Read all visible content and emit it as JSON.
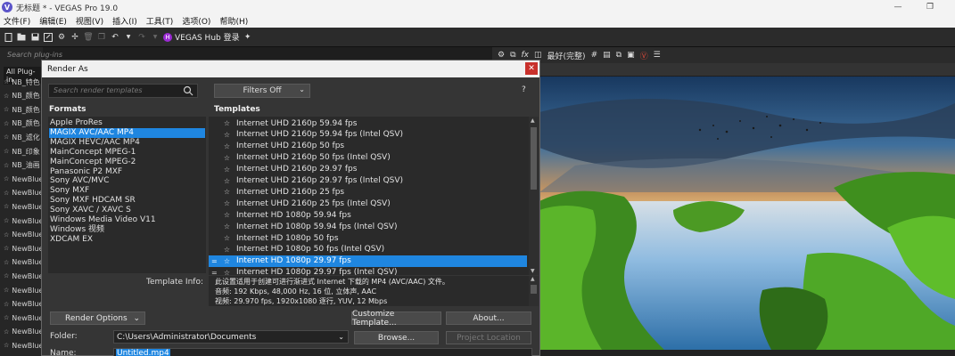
{
  "window": {
    "title": "无标题 * - VEGAS Pro 19.0",
    "app_icon": "V",
    "minimize": "—",
    "maximize": "❐"
  },
  "menu": [
    "文件(F)",
    "编辑(E)",
    "视图(V)",
    "插入(I)",
    "工具(T)",
    "选项(O)",
    "帮助(H)"
  ],
  "toolbar": {
    "hub_label": "VEGAS Hub 登录"
  },
  "plugins": {
    "search_placeholder": "Search plug-ins",
    "tab_label": "All Plug-in",
    "items": [
      "NB_特色",
      "NB_颜色",
      "NB_颜色",
      "NB_颜色",
      "NB_滤化",
      "NB_印象",
      "NB_油画",
      "NewBlue",
      "NewBlue",
      "NewBlue",
      "NewBlue",
      "NewBlue",
      "NewBlue",
      "NewBlue",
      "NewBlue",
      "NewBlue",
      "NewBlue",
      "NewBlue",
      "NewBlue",
      "NewBlue",
      "NewBlue"
    ]
  },
  "preview_toolbar": {
    "quality": "最好(完整)"
  },
  "dialog": {
    "title": "Render As",
    "close": "✕",
    "search_placeholder": "Search render templates",
    "filters_label": "Filters Off",
    "help": "?",
    "formats_header": "Formats",
    "templates_header": "Templates",
    "formats": [
      "Apple ProRes",
      "MAGIX AVC/AAC MP4",
      "MAGIX HEVC/AAC MP4",
      "MainConcept MPEG-1",
      "MainConcept MPEG-2",
      "Panasonic P2 MXF",
      "Sony AVC/MVC",
      "Sony MXF",
      "Sony MXF HDCAM SR",
      "Sony XAVC / XAVC S",
      "Windows Media Video V11",
      "Windows 视频",
      "XDCAM EX"
    ],
    "selected_format_index": 1,
    "templates": [
      "Internet UHD 2160p 59.94 fps",
      "Internet UHD 2160p 59.94 fps (Intel QSV)",
      "Internet UHD 2160p 50 fps",
      "Internet UHD 2160p 50 fps (Intel QSV)",
      "Internet UHD 2160p 29.97 fps",
      "Internet UHD 2160p 29.97 fps (Intel QSV)",
      "Internet UHD 2160p 25 fps",
      "Internet UHD 2160p 25 fps (Intel QSV)",
      "Internet HD 1080p 59.94 fps",
      "Internet HD 1080p 59.94 fps (Intel QSV)",
      "Internet HD 1080p 50 fps",
      "Internet HD 1080p 50 fps (Intel QSV)",
      "Internet HD 1080p 29.97 fps",
      "Internet HD 1080p 29.97 fps (Intel QSV)"
    ],
    "selected_template_index": 12,
    "template_info_label": "Template Info:",
    "template_info": [
      "此设置适用于创建可进行渐进式 Internet 下载的 MP4 (AVC/AAC) 文件。",
      "音频: 192 Kbps, 48,000 Hz, 16 位, 立体声, AAC",
      "视频: 29.970 fps, 1920x1080 逐行, YUV, 12 Mbps"
    ],
    "render_options": "Render Options",
    "customize_template": "Customize Template...",
    "about": "About...",
    "folder_label": "Folder:",
    "folder_value": "C:\\Users\\Administrator\\Documents",
    "browse": "Browse...",
    "project_location": "Project Location",
    "name_label": "Name:",
    "name_value": "Untitled.mp4"
  }
}
